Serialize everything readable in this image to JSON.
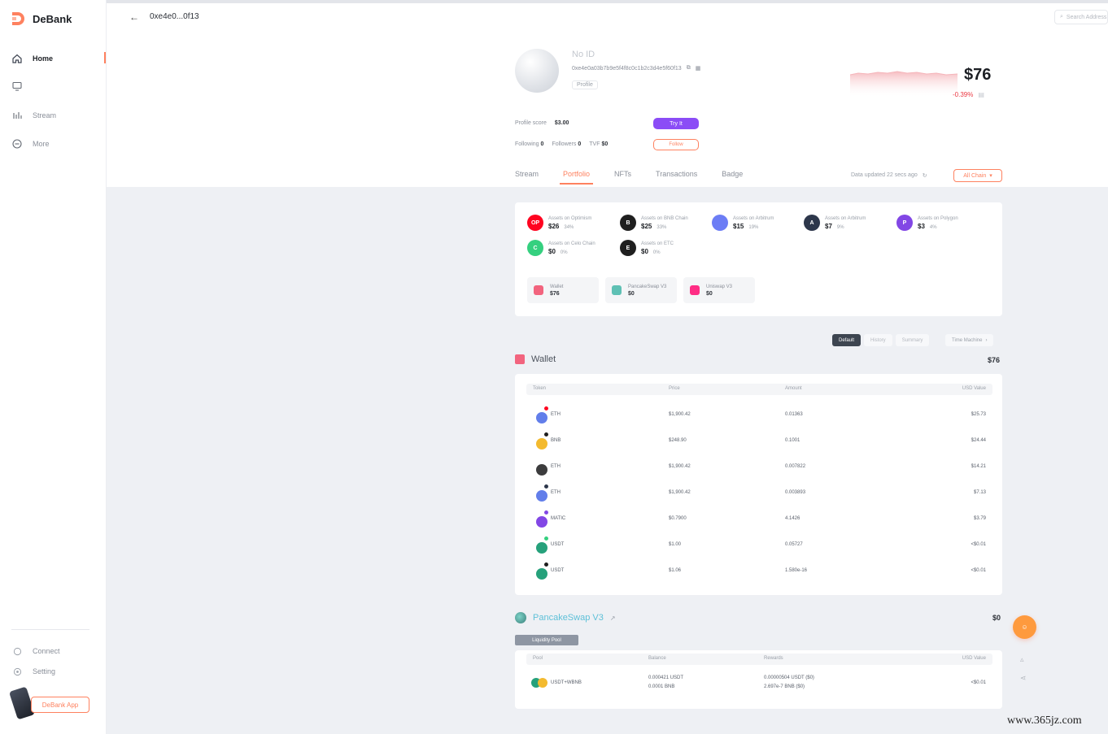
{
  "app": {
    "name": "DeBank"
  },
  "sidebar": {
    "items": [
      {
        "label": "Home",
        "icon": "home-icon",
        "active": true
      },
      {
        "label": "",
        "icon": "screen-icon",
        "active": false
      },
      {
        "label": "Stream",
        "icon": "stream-icon",
        "active": false
      },
      {
        "label": "More",
        "icon": "more-icon",
        "active": false
      }
    ],
    "bottom": [
      {
        "label": "Connect",
        "icon": "connect-icon"
      },
      {
        "label": "Setting",
        "icon": "setting-icon"
      }
    ],
    "app_button": "DeBank App"
  },
  "topbar": {
    "address": "0xe4e0...0f13",
    "search_placeholder": "Search Address"
  },
  "profile": {
    "name": "No ID",
    "address": "0xe4e0a03b7b9e5f4f8c0c1b2c3d4e5f60f13",
    "tag": "Profile",
    "net_worth": "$76",
    "change": "-0.39%",
    "spark_color": "#f5b5ba",
    "stats1": {
      "label": "Profile score",
      "value": "$3.00"
    },
    "try_button": "Try It",
    "stats2": [
      {
        "label": "Following",
        "value": "0"
      },
      {
        "label": "Followers",
        "value": "0"
      },
      {
        "label": "TVF",
        "value": "$0"
      }
    ],
    "follow_button": "Follow"
  },
  "tabs": [
    "Stream",
    "Portfolio",
    "NFTs",
    "Transactions",
    "Badge"
  ],
  "active_tab": "Portfolio",
  "data_updated": "Data updated 22 secs ago",
  "chain_select": "All Chain",
  "chains": [
    {
      "name": "Assets on Optimism",
      "value": "$26",
      "pct": "34%",
      "color": "#ff0420",
      "short": "OP"
    },
    {
      "name": "Assets on BNB Chain",
      "value": "$25",
      "pct": "33%",
      "color": "#1f1f1f",
      "short": "B"
    },
    {
      "name": "Assets on Arbitrum",
      "value": "$15",
      "pct": "19%",
      "color": "#6c7df5",
      "short": ""
    },
    {
      "name": "Assets on Arbitrum",
      "value": "$7",
      "pct": "9%",
      "color": "#2d374b",
      "short": "A"
    },
    {
      "name": "Assets on Polygon",
      "value": "$3",
      "pct": "4%",
      "color": "#8247e5",
      "short": "P"
    },
    {
      "name": "Assets on Celo Chain",
      "value": "$0",
      "pct": "0%",
      "color": "#35d07f",
      "short": "C"
    },
    {
      "name": "Assets on ETC",
      "value": "$0",
      "pct": "0%",
      "color": "#1f1f1f",
      "short": "E"
    }
  ],
  "protocols": [
    {
      "name": "Wallet",
      "value": "$76",
      "color": "#f2647e"
    },
    {
      "name": "PancakeSwap V3",
      "value": "$0",
      "color": "#5ec0b4"
    },
    {
      "name": "Uniswap V3",
      "value": "$0",
      "color": "#ff2d85"
    }
  ],
  "view_toggle": [
    "Default",
    "History",
    "Summary"
  ],
  "time_machine": "Time Machine",
  "wallet": {
    "title": "Wallet",
    "total": "$76",
    "columns": [
      "Token",
      "Price",
      "Amount",
      "USD Value"
    ],
    "rows": [
      {
        "token": "ETH",
        "price": "$1,900.42",
        "amount": "0.01363",
        "value": "$25.73",
        "color": "#627eea",
        "badge": "#ff0420"
      },
      {
        "token": "BNB",
        "price": "$248.90",
        "amount": "0.1001",
        "value": "$24.44",
        "color": "#f3ba2f",
        "badge": "#1f1f1f"
      },
      {
        "token": "ETH",
        "price": "$1,900.42",
        "amount": "0.007822",
        "value": "$14.21",
        "color": "#3c3c3d",
        "badge": "#ffffff"
      },
      {
        "token": "ETH",
        "price": "$1,900.42",
        "amount": "0.003893",
        "value": "$7.13",
        "color": "#627eea",
        "badge": "#2d374b"
      },
      {
        "token": "MATIC",
        "price": "$0.7900",
        "amount": "4.1426",
        "value": "$3.79",
        "color": "#8247e5",
        "badge": "#8247e5"
      },
      {
        "token": "USDT",
        "price": "$1.00",
        "amount": "0.05727",
        "value": "<$0.01",
        "color": "#26a17b",
        "badge": "#35d07f"
      },
      {
        "token": "USDT",
        "price": "$1.06",
        "amount": "1.580e-16",
        "value": "<$0.01",
        "color": "#26a17b",
        "badge": "#1f1f1f"
      }
    ]
  },
  "pancake": {
    "title": "PancakeSwap V3",
    "total": "$0",
    "label": "Liquidity Pool",
    "columns": [
      "Pool",
      "Balance",
      "Rewards",
      "USD Value"
    ],
    "rows": [
      {
        "pool": "USDT+WBNB",
        "balance1": "0.000421 USDT",
        "balance2": "0.0001 BNB",
        "reward1": "0.00000504 USDT ($0)",
        "reward2": "2.697e-7 BNB ($0)",
        "value": "<$0.01"
      }
    ]
  },
  "watermark": "www.365jz.com"
}
